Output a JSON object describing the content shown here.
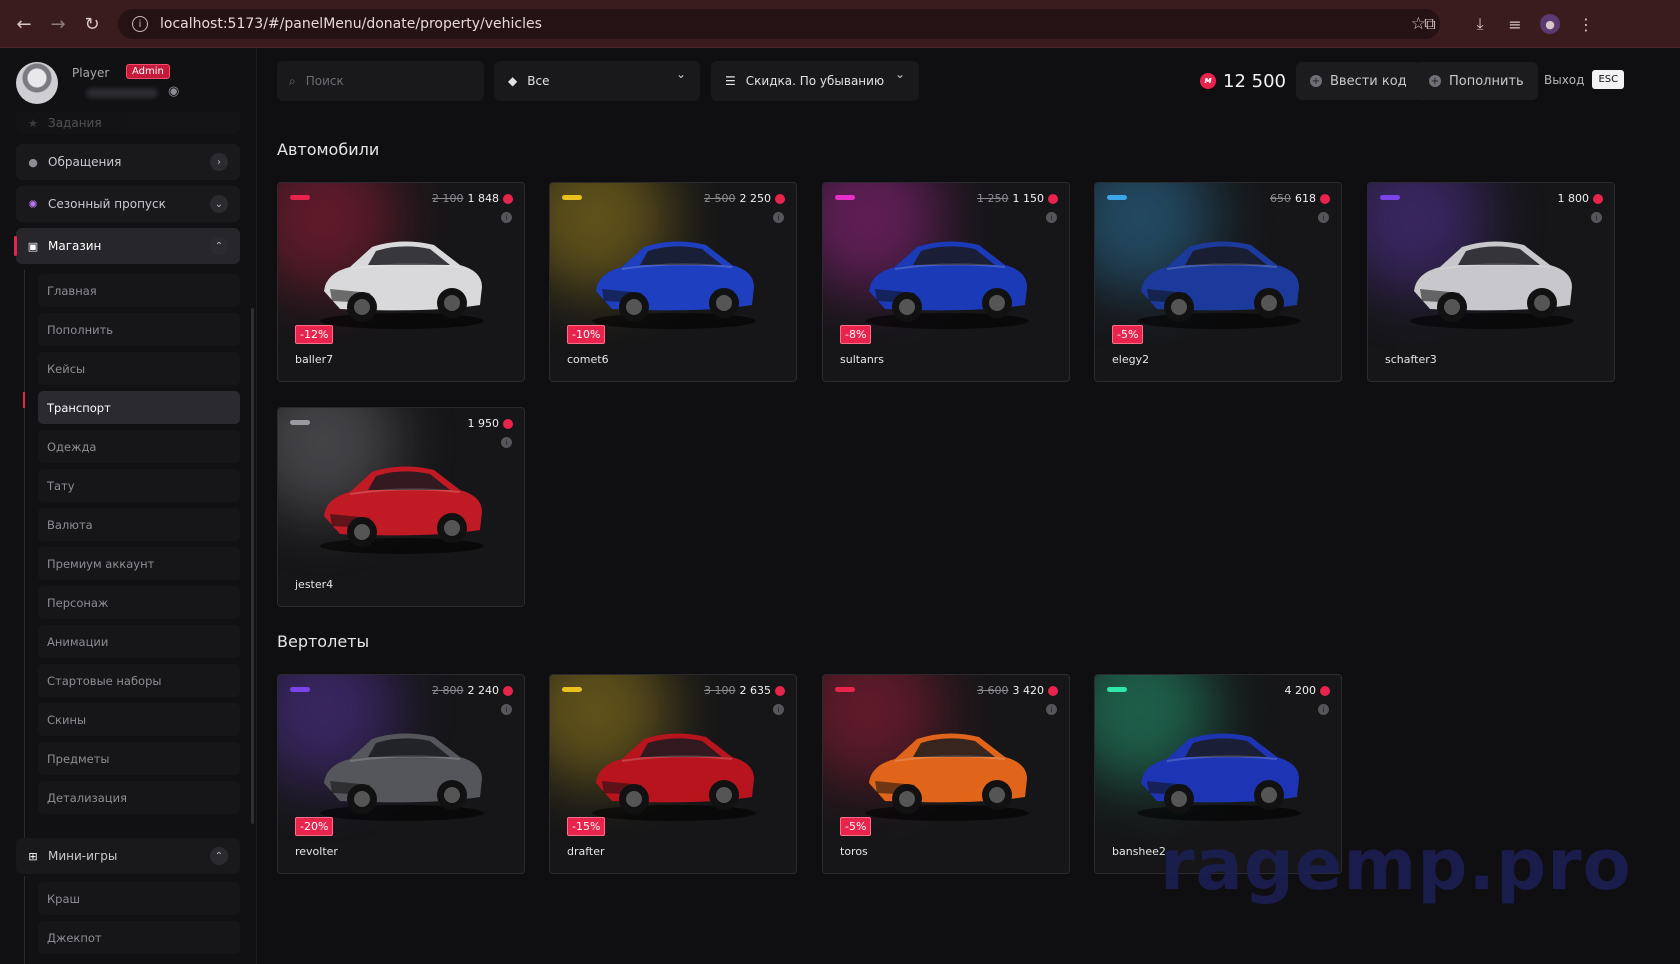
{
  "browser": {
    "url": "localhost:5173/#/panelMenu/donate/property/vehicles"
  },
  "profile": {
    "name": "Player",
    "badge": "Admin"
  },
  "sidebar": {
    "top_items": [
      {
        "label": "Задания",
        "icon": "star-icon"
      },
      {
        "label": "Обращения",
        "icon": "chat-icon"
      },
      {
        "label": "Сезонный пропуск",
        "icon": "sparkle-icon"
      },
      {
        "label": "Магазин",
        "icon": "bag-icon"
      }
    ],
    "shop_items": [
      "Главная",
      "Пополнить",
      "Кейсы",
      "Транспорт",
      "Одежда",
      "Тату",
      "Валюта",
      "Премиум аккаунт",
      "Персонаж",
      "Анимации",
      "Стартовые наборы",
      "Скины",
      "Предметы",
      "Детализация"
    ],
    "active_shop_item": "Транспорт",
    "mini_games": {
      "label": "Мини-игры",
      "items": [
        "Краш",
        "Джекпот"
      ]
    }
  },
  "toolbar": {
    "search_placeholder": "Поиск",
    "filter_value": "Все",
    "sort_value": "Скидка. По убыванию",
    "balance": "12 500",
    "redeem_label": "Ввести код",
    "topup_label": "Пополнить",
    "exit_label": "Выход",
    "esc_label": "ESC"
  },
  "sections": [
    {
      "title": "Автомобили",
      "cards": [
        {
          "name": "baller7",
          "old_price": "2 100",
          "price": "1 848",
          "discount": "-12%",
          "tag_color": "#e8244d",
          "car_color": "#d9d9dc"
        },
        {
          "name": "comet6",
          "old_price": "2 500",
          "price": "2 250",
          "discount": "-10%",
          "tag_color": "#e8c020",
          "car_color": "#1e3fc0"
        },
        {
          "name": "sultanrs",
          "old_price": "1 250",
          "price": "1 150",
          "discount": "-8%",
          "tag_color": "#e82fc8",
          "car_color": "#1b3ab8"
        },
        {
          "name": "elegy2",
          "old_price": "650",
          "price": "618",
          "discount": "-5%",
          "tag_color": "#3aa8e8",
          "car_color": "#1c3a9c"
        },
        {
          "name": "schafter3",
          "old_price": "",
          "price": "1 800",
          "discount": "",
          "tag_color": "#7a44e8",
          "car_color": "#c8c8cc"
        },
        {
          "name": "jester4",
          "old_price": "",
          "price": "1 950",
          "discount": "",
          "tag_color": "#9a9aa0",
          "car_color": "#c01a24"
        }
      ]
    },
    {
      "title": "Вертолеты",
      "cards": [
        {
          "name": "revolter",
          "old_price": "2 800",
          "price": "2 240",
          "discount": "-20%",
          "tag_color": "#7a44e8",
          "car_color": "#55565c"
        },
        {
          "name": "drafter",
          "old_price": "3 100",
          "price": "2 635",
          "discount": "-15%",
          "tag_color": "#e8c020",
          "car_color": "#b8141e"
        },
        {
          "name": "toros",
          "old_price": "3 600",
          "price": "3 420",
          "discount": "-5%",
          "tag_color": "#e8244d",
          "car_color": "#e0641a"
        },
        {
          "name": "banshee2",
          "old_price": "",
          "price": "4 200",
          "discount": "",
          "tag_color": "#2ee8a8",
          "car_color": "#1d35b4"
        }
      ]
    }
  ],
  "watermark": "ragemp.pro"
}
